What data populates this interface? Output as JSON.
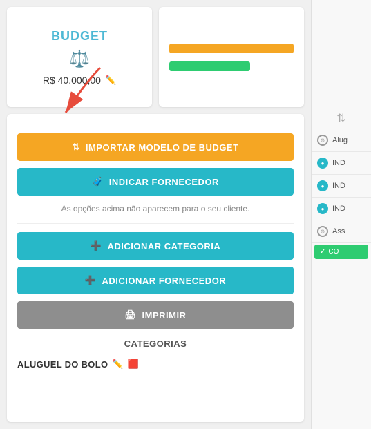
{
  "budget": {
    "title": "BUDGET",
    "amount": "R$ 40.000,00",
    "icon": "⚖",
    "chart_bar1_color": "#f5a623",
    "chart_bar2_color": "#2ecc71"
  },
  "buttons": {
    "import_budget": "IMPORTAR MODELO DE BUDGET",
    "indicate_supplier": "INDICAR FORNECEDOR",
    "note": "As opções acima não aparecem para o seu cliente.",
    "add_category": "ADICIONAR CATEGORIA",
    "add_supplier": "ADICIONAR FORNECEDOR",
    "print": "IMPRIMIR",
    "categories_label": "CATEGORIAS",
    "category_name": "ALUGUEL DO BOLO"
  },
  "sidebar": {
    "toggle_icon": "⇅",
    "items": [
      {
        "label": "Alug",
        "type": "gray"
      },
      {
        "label": "IND",
        "type": "teal"
      },
      {
        "label": "IND",
        "type": "teal"
      },
      {
        "label": "IND",
        "type": "teal"
      },
      {
        "label": "Ass",
        "type": "gray"
      }
    ],
    "action_label": "CO"
  }
}
